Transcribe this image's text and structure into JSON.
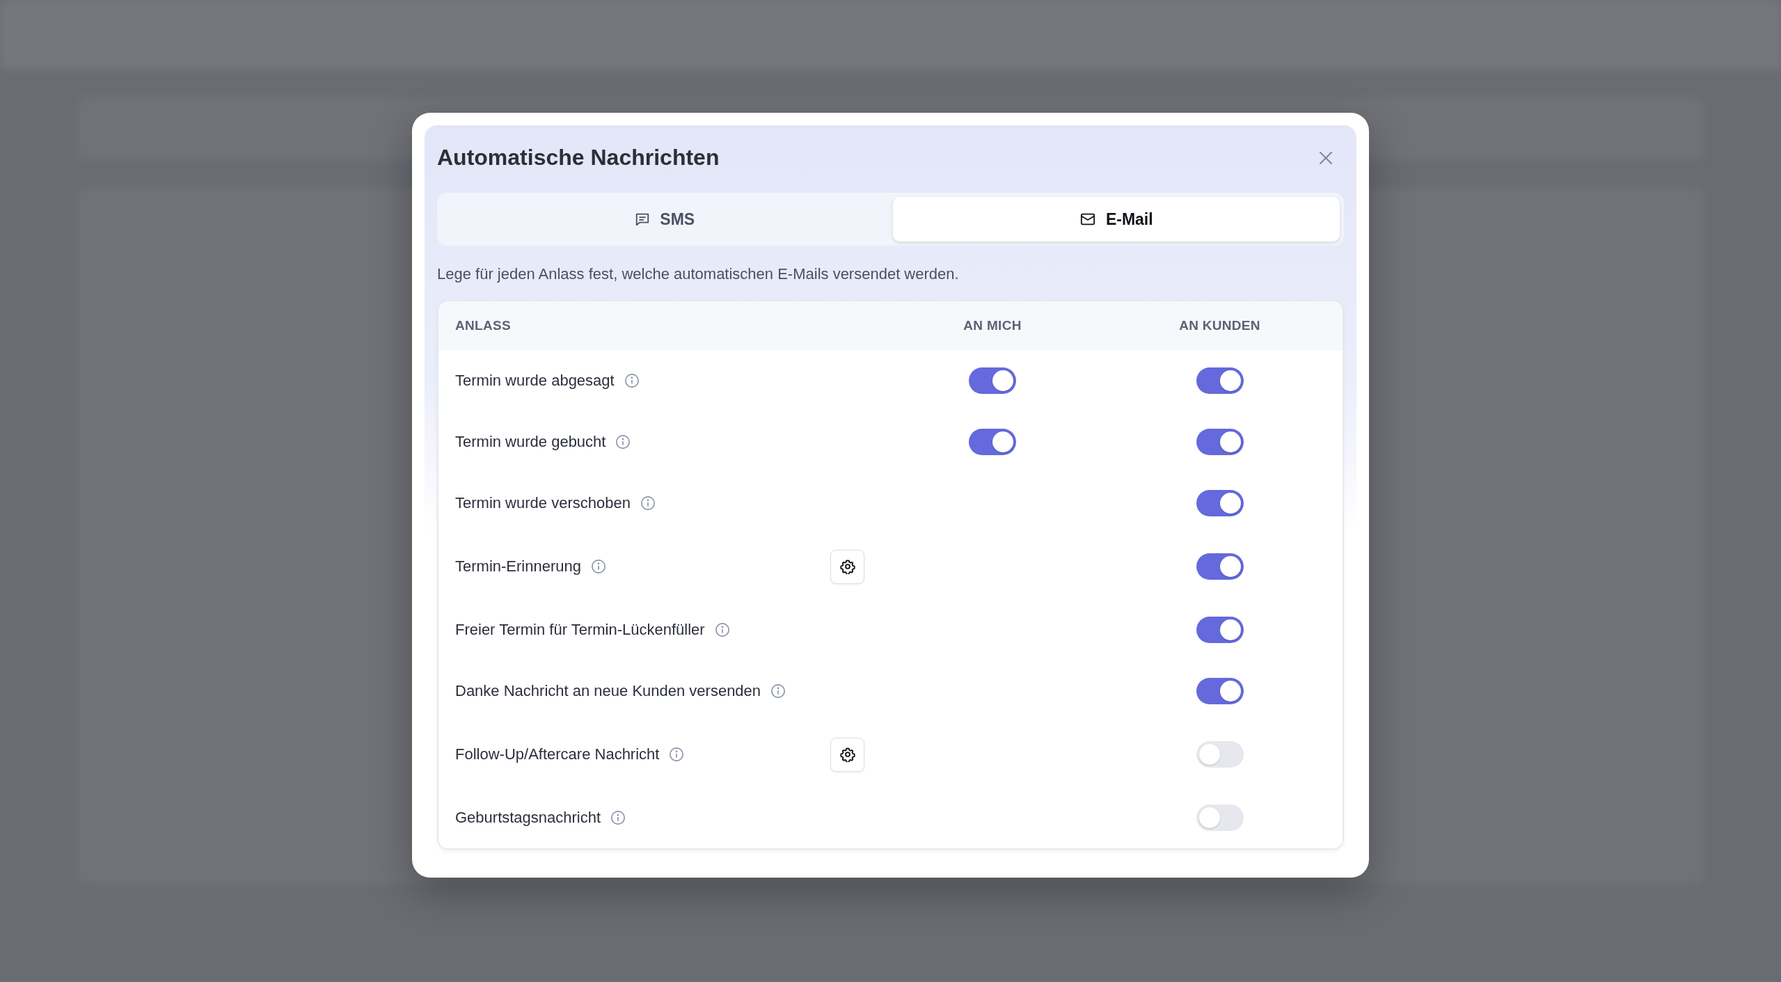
{
  "dialog": {
    "title": "Automatische Nachrichten",
    "tabs": [
      {
        "label": "SMS",
        "kind": "sms",
        "selected": false
      },
      {
        "label": "E-Mail",
        "kind": "mail",
        "selected": true
      }
    ],
    "description": "Lege für jeden Anlass fest, welche automatischen E-Mails versendet werden.",
    "table": {
      "columns": [
        "ANLASS",
        "AN MICH",
        "AN KUNDEN"
      ],
      "rows": [
        {
          "label": "Termin wurde abgesagt",
          "settings": false,
          "to_me": {
            "on": true
          },
          "to_customer": {
            "on": true
          }
        },
        {
          "label": "Termin wurde gebucht",
          "settings": false,
          "to_me": {
            "on": true
          },
          "to_customer": {
            "on": true
          }
        },
        {
          "label": "Termin wurde verschoben",
          "settings": false,
          "to_customer": {
            "on": true
          }
        },
        {
          "label": "Termin-Erinnerung",
          "settings": true,
          "to_customer": {
            "on": true
          }
        },
        {
          "label": "Freier Termin für Termin-Lückenfüller",
          "settings": false,
          "to_customer": {
            "on": true
          }
        },
        {
          "label": "Danke Nachricht an neue Kunden versenden",
          "settings": false,
          "to_customer": {
            "on": true
          }
        },
        {
          "label": "Follow-Up/Aftercare Nachricht",
          "settings": true,
          "to_customer": {
            "on": false
          }
        },
        {
          "label": "Geburtstagsnachricht",
          "settings": false,
          "to_customer": {
            "on": false
          }
        }
      ]
    }
  }
}
